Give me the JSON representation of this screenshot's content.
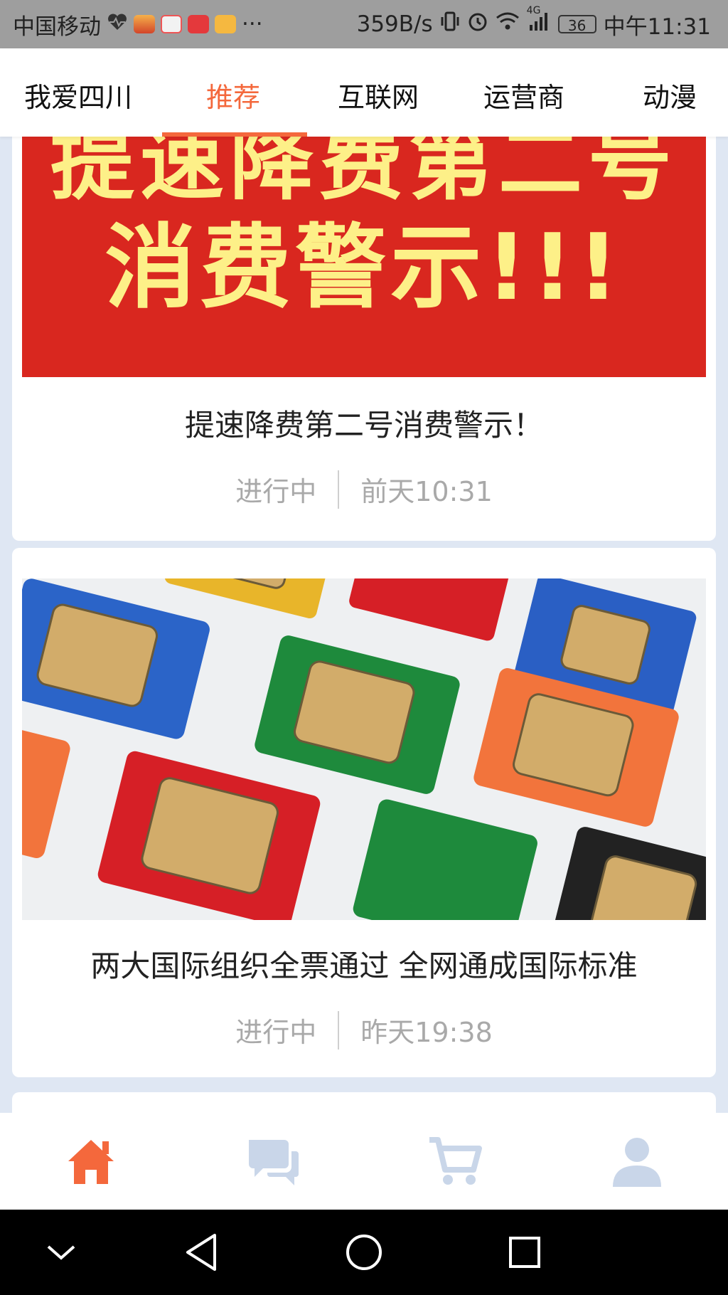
{
  "status_bar": {
    "carrier": "中国移动",
    "net_speed": "359B/s",
    "network": "4G",
    "battery": "36",
    "time": "中午11:31",
    "more": "···",
    "notification_icons": [
      "heart-rate-icon",
      "game-icon",
      "bike-icon",
      "jd-icon",
      "mail-icon"
    ]
  },
  "top_tabs": [
    {
      "label": "我爱四川",
      "active": false
    },
    {
      "label": "推荐",
      "active": true
    },
    {
      "label": "互联网",
      "active": false
    },
    {
      "label": "运营商",
      "active": false
    },
    {
      "label": "动漫",
      "active": false
    }
  ],
  "accent_color": "#f4683c",
  "cards": [
    {
      "image_text_line1": "提速降费第二号",
      "image_text_line2": "消费警示!!!",
      "title": "提速降费第二号消费警示！",
      "status": "进行中",
      "time": "前天10:31"
    },
    {
      "image_alt": "sim-cards-image",
      "title": "两大国际组织全票通过 全网通成国际标准",
      "status": "进行中",
      "time": "昨天19:38"
    }
  ],
  "bottom_tabs": [
    {
      "icon": "home-icon",
      "active": true
    },
    {
      "icon": "chat-icon",
      "active": false
    },
    {
      "icon": "cart-icon",
      "active": false
    },
    {
      "icon": "profile-icon",
      "active": false
    }
  ],
  "android_nav": [
    "collapse-icon",
    "back-icon",
    "home-circle-icon",
    "recents-icon"
  ]
}
